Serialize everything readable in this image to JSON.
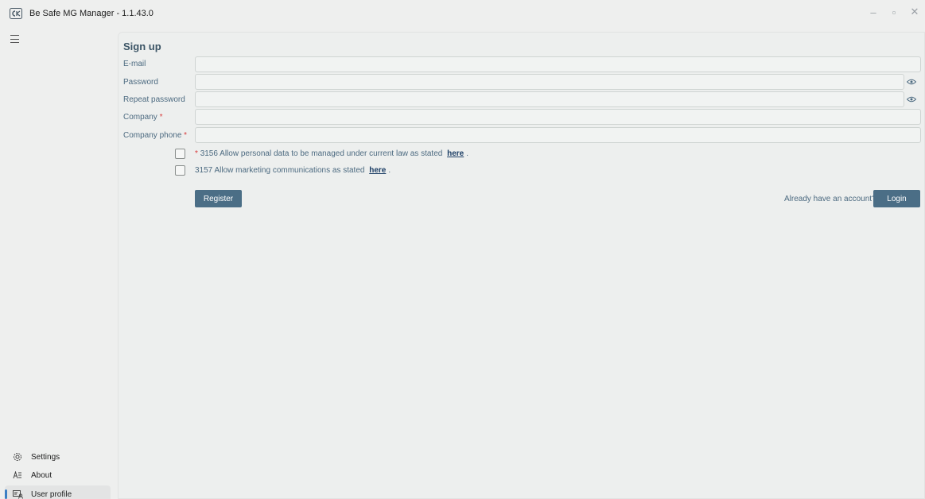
{
  "window": {
    "title": "Be Safe MG Manager - 1.1.43.0",
    "controls": {
      "minimize": "–",
      "restore": "▫",
      "close": "✕"
    }
  },
  "sidebar": {
    "menu_icon": "hamburger-icon",
    "items": [
      {
        "label": "Settings",
        "icon": "gear-icon"
      },
      {
        "label": "About",
        "icon": "about-icon"
      },
      {
        "label": "User profile",
        "icon": "user-profile-icon",
        "active": true
      }
    ]
  },
  "signup": {
    "title": "Sign up",
    "fields": [
      {
        "label": "E-mail",
        "required": false,
        "value": ""
      },
      {
        "label": "Password",
        "required": false,
        "value": "",
        "icon": "eye-icon"
      },
      {
        "label": "Repeat password",
        "required": false,
        "value": "",
        "icon": "eye-icon"
      },
      {
        "label": "Company",
        "required": true,
        "value": ""
      },
      {
        "label": "Company phone",
        "required": true,
        "value": ""
      }
    ],
    "required_marker": "*",
    "consents": [
      {
        "required": true,
        "text": "3156 Allow personal data to be managed under current law as stated",
        "link": "here",
        "suffix": ".",
        "checked": false
      },
      {
        "required": false,
        "text": "3157 Allow marketing communications as stated",
        "link": "here",
        "suffix": ".",
        "checked": false
      }
    ],
    "register_label": "Register",
    "have_account_text": "Already have an account?",
    "login_label": "Login"
  },
  "colors": {
    "accent": "#4b6e86",
    "label": "#4c6a80",
    "required": "#d83b3b",
    "active_indicator": "#3b7fc4"
  }
}
